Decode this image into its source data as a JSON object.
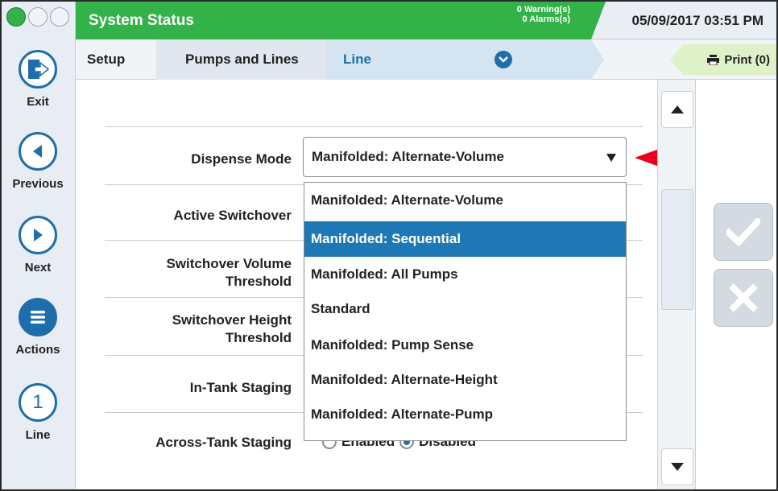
{
  "header": {
    "title": "System Status",
    "warnings": "0 Warning(s)",
    "alarms": "0 Alarms(s)",
    "datetime": "05/09/2017 03:51 PM"
  },
  "breadcrumb": {
    "items": [
      "Setup",
      "Pumps and Lines",
      "Line"
    ]
  },
  "print_label": "Print (0)",
  "nav": {
    "exit": "Exit",
    "previous": "Previous",
    "next": "Next",
    "actions": "Actions",
    "line": "Line",
    "line_number": "1"
  },
  "form": {
    "rows": [
      "Dispense Mode",
      "Active Switchover",
      "Switchover Volume\nThreshold",
      "Switchover Height\nThreshold",
      "In-Tank Staging",
      "Across-Tank Staging"
    ],
    "dispense_mode_value": "Manifolded: Alternate-Volume",
    "dropdown_options": [
      "Manifolded: Alternate-Volume",
      "Manifolded: Sequential",
      "Manifolded: All Pumps",
      "Standard",
      "Manifolded: Pump Sense",
      "Manifolded: Alternate-Height",
      "Manifolded: Alternate-Pump"
    ],
    "highlighted_option": "Manifolded: Sequential",
    "across_tank_enabled": "Enabled",
    "across_tank_disabled": "Disabled"
  },
  "colors": {
    "header_green": "#33b24a",
    "accent_blue": "#1d6eaa",
    "selection_blue": "#1e78b5",
    "pointer_red": "#e8001c"
  },
  "icons": [
    "exit-icon",
    "previous-icon",
    "next-icon",
    "actions-menu-icon",
    "printer-icon",
    "check-icon",
    "close-icon",
    "scroll-up-icon",
    "scroll-down-icon",
    "chevron-down-icon"
  ]
}
